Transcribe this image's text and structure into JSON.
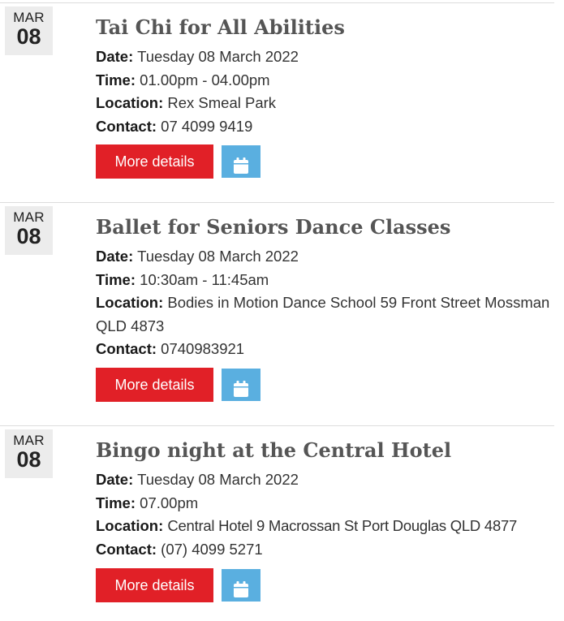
{
  "events": [
    {
      "month": "MAR",
      "day": "08",
      "title": "Tai Chi for All Abilities",
      "date_label": "Date:",
      "date_value": "Tuesday 08 March 2022",
      "time_label": "Time:",
      "time_value": "01.00pm - 04.00pm",
      "location_label": "Location:",
      "location_value": "Rex Smeal Park",
      "contact_label": "Contact:",
      "contact_value": "07 4099 9419",
      "more_label": "More details",
      "calendar_icon": "calendar-icon"
    },
    {
      "month": "MAR",
      "day": "08",
      "title": "Ballet for Seniors Dance Classes",
      "date_label": "Date:",
      "date_value": "Tuesday 08 March 2022",
      "time_label": "Time:",
      "time_value": "10:30am - 11:45am",
      "location_label": "Location:",
      "location_value": "Bodies in Motion Dance School 59 Front Street Mossman QLD 4873",
      "contact_label": "Contact:",
      "contact_value": "0740983921",
      "more_label": "More details",
      "calendar_icon": "calendar-icon"
    },
    {
      "month": "MAR",
      "day": "08",
      "title": "Bingo night at the Central Hotel",
      "date_label": "Date:",
      "date_value": "Tuesday 08 March 2022",
      "time_label": "Time:",
      "time_value": "07.00pm",
      "location_label": "Location:",
      "location_value": "Central Hotel 9 Macrossan St Port Douglas QLD 4877",
      "contact_label": "Contact:",
      "contact_value": "(07) 4099 5271",
      "more_label": "More details",
      "calendar_icon": "calendar-icon"
    }
  ],
  "colors": {
    "more_button": "#e12027",
    "calendar_button": "#5aafe0",
    "date_badge": "#ececec",
    "title": "#555555"
  }
}
